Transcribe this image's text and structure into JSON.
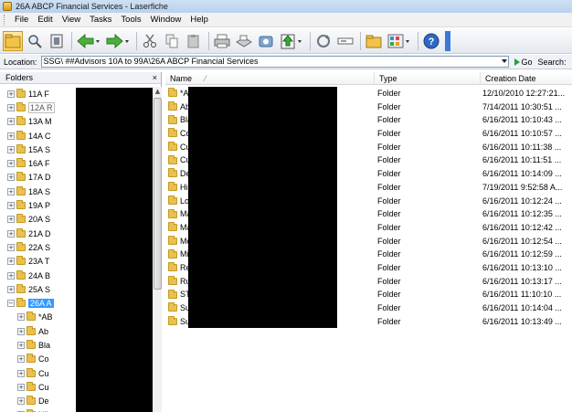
{
  "window": {
    "title": "26A ABCP Financial Services - Laserfiche"
  },
  "menu": [
    "File",
    "Edit",
    "View",
    "Tasks",
    "Tools",
    "Window",
    "Help"
  ],
  "toolbar": {
    "icons": [
      "folder-browser-icon",
      "search-icon",
      "columns-icon",
      "back-arrow-icon",
      "forward-arrow-icon",
      "cut-icon",
      "copy-icon",
      "paste-icon",
      "print-icon",
      "scan-icon",
      "import-icon",
      "upload-icon",
      "refresh-icon",
      "rename-icon",
      "new-folder-icon",
      "view-options-icon",
      "help-icon"
    ]
  },
  "location": {
    "label": "Location:",
    "value": "SSG\\ ##Advisors 10A to 99A\\26A ABCP Financial Services",
    "go_label": "Go",
    "search_label": "Search:"
  },
  "folders_pane": {
    "title": "Folders",
    "close_label": "×",
    "items": [
      {
        "label": "11A F",
        "expander": "+"
      },
      {
        "label": "12A R",
        "expander": "+",
        "style": "boxed"
      },
      {
        "label": "13A M",
        "expander": "+"
      },
      {
        "label": "14A C",
        "expander": "+"
      },
      {
        "label": "15A S",
        "expander": "+"
      },
      {
        "label": "16A F",
        "expander": "+"
      },
      {
        "label": "17A D",
        "expander": "+"
      },
      {
        "label": "18A S",
        "expander": "+"
      },
      {
        "label": "19A P",
        "expander": "+"
      },
      {
        "label": "20A S",
        "expander": "+"
      },
      {
        "label": "21A D",
        "expander": "+"
      },
      {
        "label": "22A S",
        "expander": "+"
      },
      {
        "label": "23A T",
        "expander": "+"
      },
      {
        "label": "24A B",
        "expander": "+"
      },
      {
        "label": "25A S",
        "expander": "+"
      },
      {
        "label": "26A A",
        "expander": "−",
        "style": "selected"
      },
      {
        "label": "*AB",
        "expander": "+",
        "indent": 1
      },
      {
        "label": "Ab",
        "expander": "+",
        "indent": 1
      },
      {
        "label": "Bla",
        "expander": "+",
        "indent": 1
      },
      {
        "label": "Co",
        "expander": "+",
        "indent": 1
      },
      {
        "label": "Cu",
        "expander": "+",
        "indent": 1
      },
      {
        "label": "Cu",
        "expander": "+",
        "indent": 1
      },
      {
        "label": "De",
        "expander": "+",
        "indent": 1
      },
      {
        "label": "Hil",
        "expander": "+",
        "indent": 1
      }
    ]
  },
  "list": {
    "columns": {
      "name": "Name",
      "type": "Type",
      "date": "Creation Date"
    },
    "rows": [
      {
        "name": "*A",
        "type": "Folder",
        "date": "12/10/2010 12:27:21..."
      },
      {
        "name": "Ab",
        "type": "Folder",
        "date": "7/14/2011 10:30:51 ..."
      },
      {
        "name": "Bla",
        "type": "Folder",
        "date": "6/16/2011 10:10:43 ..."
      },
      {
        "name": "Co",
        "type": "Folder",
        "date": "6/16/2011 10:10:57 ..."
      },
      {
        "name": "Cu",
        "type": "Folder",
        "date": "6/16/2011 10:11:38 ..."
      },
      {
        "name": "Cu",
        "type": "Folder",
        "date": "6/16/2011 10:11:51 ..."
      },
      {
        "name": "De",
        "type": "Folder",
        "date": "6/16/2011 10:14:09 ..."
      },
      {
        "name": "Hil",
        "type": "Folder",
        "date": "7/19/2011 9:52:58 A..."
      },
      {
        "name": "Lo",
        "type": "Folder",
        "date": "6/16/2011 10:12:24 ..."
      },
      {
        "name": "Ma",
        "type": "Folder",
        "date": "6/16/2011 10:12:35 ..."
      },
      {
        "name": "Ma",
        "type": "Folder",
        "date": "6/16/2011 10:12:42 ..."
      },
      {
        "name": "Mo",
        "type": "Folder",
        "date": "6/16/2011 10:12:54 ..."
      },
      {
        "name": "Mi",
        "type": "Folder",
        "date": "6/16/2011 10:12:59 ..."
      },
      {
        "name": "Re",
        "type": "Folder",
        "date": "6/16/2011 10:13:10 ..."
      },
      {
        "name": "Ru",
        "type": "Folder",
        "date": "6/16/2011 10:13:17 ..."
      },
      {
        "name": "ST",
        "type": "Folder",
        "date": "6/16/2011 11:10:10 ..."
      },
      {
        "name": "Su",
        "type": "Folder",
        "date": "6/16/2011 10:14:04 ..."
      },
      {
        "name": "Su",
        "type": "Folder",
        "date": "6/16/2011 10:13:49 ..."
      }
    ]
  },
  "colors": {
    "selection": "#3399ff",
    "folder": "#e8c14f",
    "redaction": "#000000",
    "toolbar_bg": "#e4e9f0"
  }
}
